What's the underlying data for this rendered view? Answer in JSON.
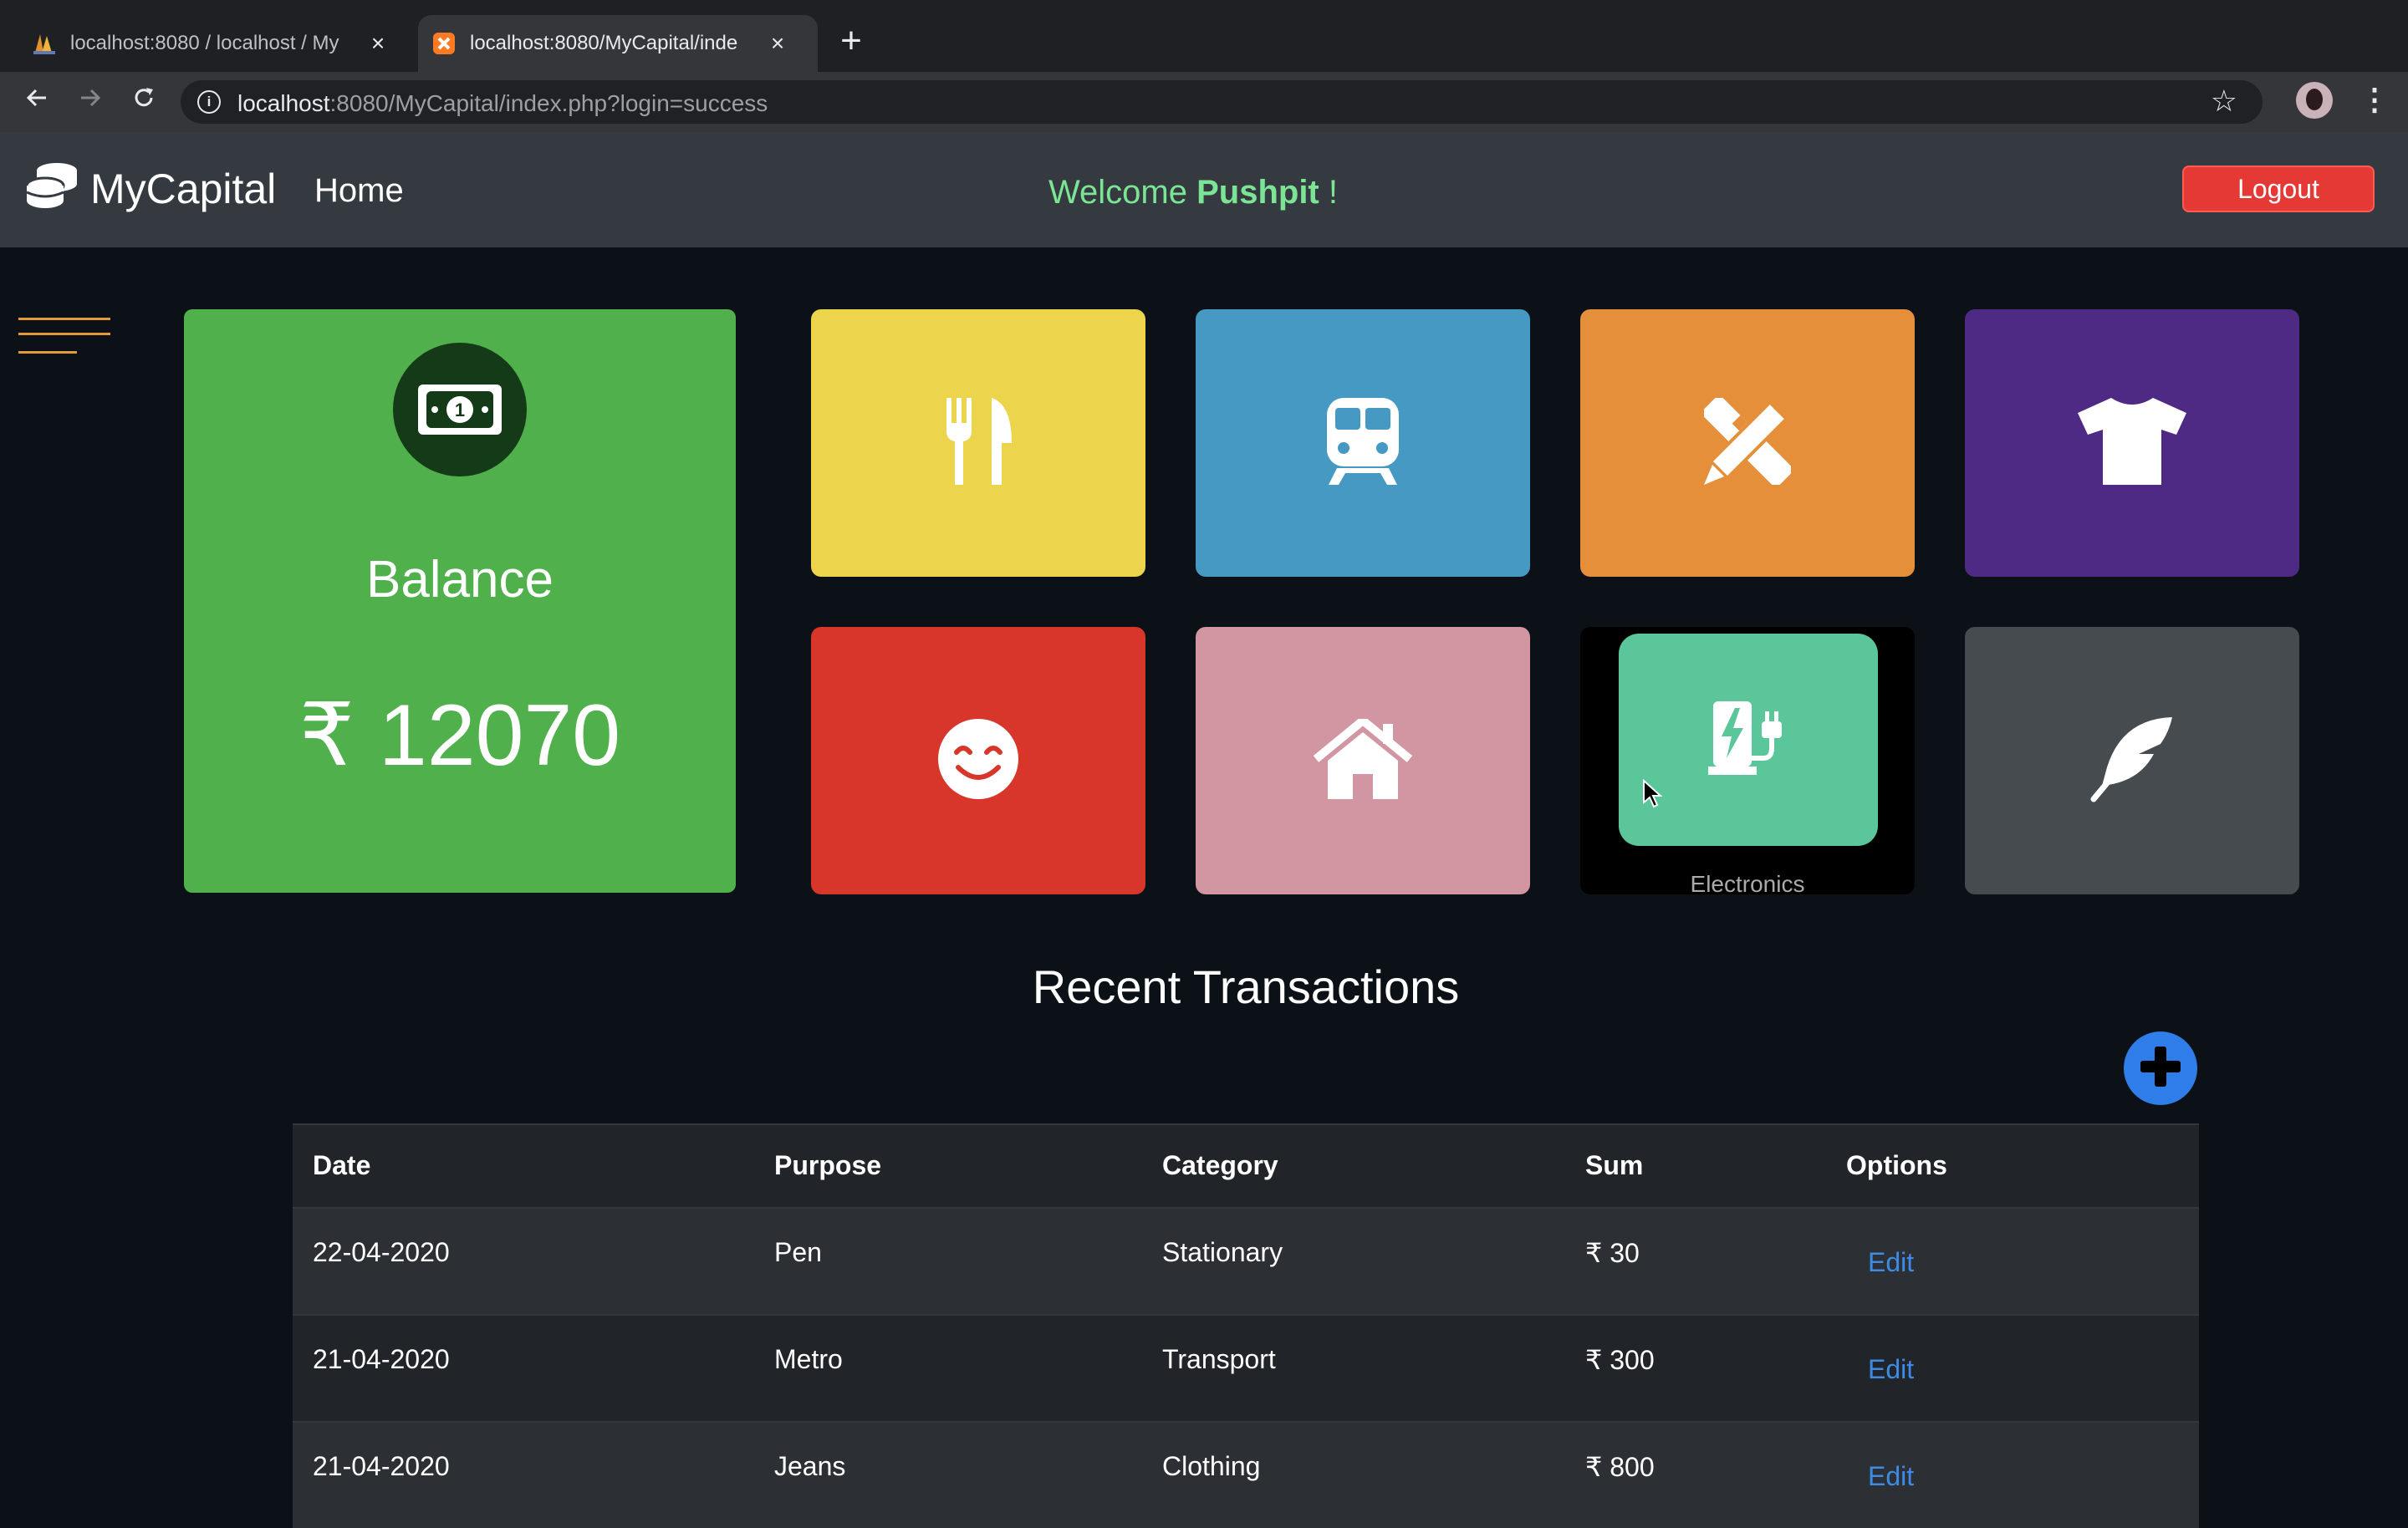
{
  "browser": {
    "tabs": [
      {
        "title": "localhost:8080 / localhost / My",
        "active": false
      },
      {
        "title": "localhost:8080/MyCapital/inde",
        "active": true
      }
    ],
    "url_host": "localhost",
    "url_rest": ":8080/MyCapital/index.php?login=success"
  },
  "navbar": {
    "brand": "MyCapital",
    "home": "Home",
    "welcome_prefix": "Welcome ",
    "username": "Pushpit",
    "welcome_suffix": " !",
    "logout": "Logout"
  },
  "balance": {
    "title": "Balance",
    "amount": "₹ 12070"
  },
  "categories": [
    {
      "icon": "utensils-icon",
      "color": "#ecd44c"
    },
    {
      "icon": "train-icon",
      "color": "#4599c3"
    },
    {
      "icon": "pencil-ruler-icon",
      "color": "#e58f3a"
    },
    {
      "icon": "tshirt-icon",
      "color": "#4e2a84"
    },
    {
      "icon": "smile-icon",
      "color": "#d8362a"
    },
    {
      "icon": "home-icon",
      "color": "#d295a2"
    },
    {
      "icon": "charging-station-icon",
      "color": "#5ac699",
      "label": "Electronics"
    },
    {
      "icon": "feather-icon",
      "color": "#464b4f"
    }
  ],
  "transactions": {
    "title": "Recent Transactions",
    "headers": [
      "Date",
      "Purpose",
      "Category",
      "Sum",
      "Options"
    ],
    "rows": [
      {
        "date": "22-04-2020",
        "purpose": "Pen",
        "category": "Stationary",
        "sum": "₹  30",
        "option": "Edit"
      },
      {
        "date": "21-04-2020",
        "purpose": "Metro",
        "category": "Transport",
        "sum": "₹  300",
        "option": "Edit"
      },
      {
        "date": "21-04-2020",
        "purpose": "Jeans",
        "category": "Clothing",
        "sum": "₹  800",
        "option": "Edit"
      }
    ]
  }
}
